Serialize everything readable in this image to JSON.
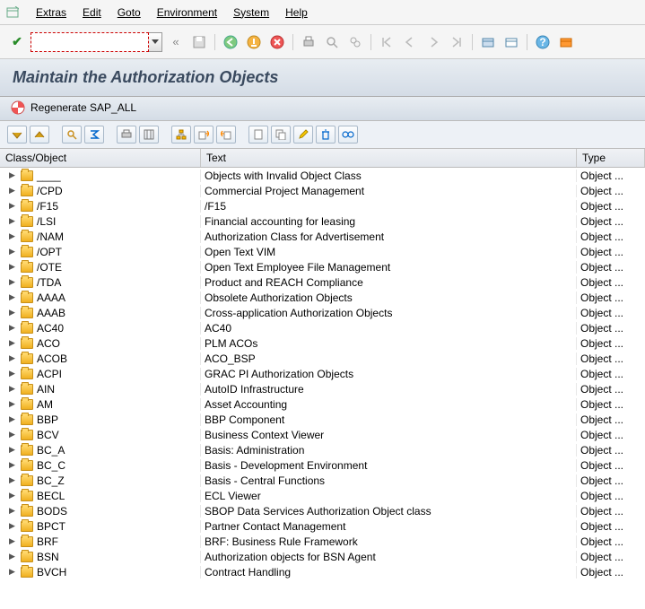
{
  "menu": {
    "extras": "Extras",
    "edit": "Edit",
    "goto": "Goto",
    "environment": "Environment",
    "system": "System",
    "help": "Help"
  },
  "toolbar": {
    "command_value": "",
    "back_hint": "«"
  },
  "title": "Maintain the Authorization Objects",
  "regenerate_label": "Regenerate SAP_ALL",
  "columns": {
    "class": "Class/Object",
    "text": "Text",
    "type": "Type"
  },
  "type_cell": "Object ...",
  "rows": [
    {
      "c": "____",
      "t": "Objects with Invalid Object Class"
    },
    {
      "c": "/CPD",
      "t": "Commercial Project Management"
    },
    {
      "c": "/F15",
      "t": "/F15"
    },
    {
      "c": "/LSI",
      "t": "Financial accounting for leasing"
    },
    {
      "c": "/NAM",
      "t": "Authorization Class for Advertisement"
    },
    {
      "c": "/OPT",
      "t": "Open Text VIM"
    },
    {
      "c": "/OTE",
      "t": "Open Text Employee File Management"
    },
    {
      "c": "/TDA",
      "t": "Product and REACH Compliance"
    },
    {
      "c": "AAAA",
      "t": "Obsolete Authorization Objects"
    },
    {
      "c": "AAAB",
      "t": "Cross-application Authorization Objects"
    },
    {
      "c": "AC40",
      "t": "AC40"
    },
    {
      "c": "ACO",
      "t": "PLM ACOs"
    },
    {
      "c": "ACOB",
      "t": "ACO_BSP"
    },
    {
      "c": "ACPI",
      "t": "GRAC PI Authorization Objects"
    },
    {
      "c": "AIN",
      "t": "AutoID Infrastructure"
    },
    {
      "c": "AM",
      "t": "Asset Accounting"
    },
    {
      "c": "BBP",
      "t": "BBP Component"
    },
    {
      "c": "BCV",
      "t": "Business Context Viewer"
    },
    {
      "c": "BC_A",
      "t": "Basis: Administration"
    },
    {
      "c": "BC_C",
      "t": "Basis - Development Environment"
    },
    {
      "c": "BC_Z",
      "t": "Basis - Central Functions"
    },
    {
      "c": "BECL",
      "t": "ECL Viewer"
    },
    {
      "c": "BODS",
      "t": "SBOP Data Services Authorization Object class"
    },
    {
      "c": "BPCT",
      "t": "Partner Contact Management"
    },
    {
      "c": "BRF",
      "t": "BRF: Business Rule Framework"
    },
    {
      "c": "BSN",
      "t": "Authorization objects for BSN Agent"
    },
    {
      "c": "BVCH",
      "t": "Contract Handling"
    }
  ]
}
